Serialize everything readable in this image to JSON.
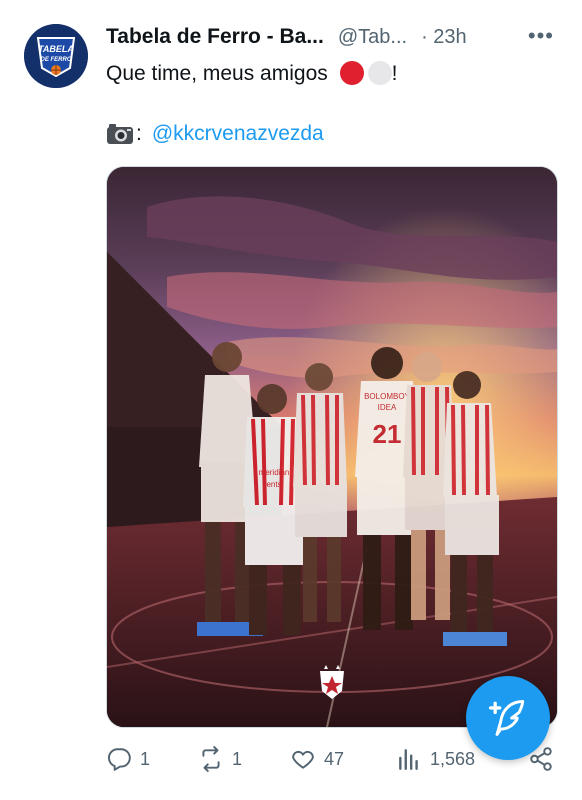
{
  "tweet": {
    "author_name": "Tabela de Ferro - Ba...",
    "author_handle": "@Tab...",
    "separator": "·",
    "time": "23h",
    "text": "Que time, meus amigos",
    "text_end": "!",
    "camera_suffix": ":",
    "mention": "@kkcrvenazvezda",
    "avatar_logo_lines": [
      "TABELA",
      "DE FERRO"
    ],
    "image_jersey_texts": {
      "sponsor_1": "meridian",
      "sponsor_2": "ents",
      "sponsor_3": "BOLOMBOY",
      "sponsor_4": "IDEA",
      "number": "21"
    }
  },
  "actions": {
    "replies": "1",
    "reposts": "1",
    "likes": "47",
    "views": "1,568"
  },
  "icons": {
    "more": "more-dots-icon",
    "reply": "reply-icon",
    "repost": "repost-icon",
    "like": "heart-icon",
    "views": "views-chart-icon",
    "share": "share-icon",
    "compose": "compose-feather-icon",
    "camera": "camera-icon"
  },
  "colors": {
    "accent": "#1d9bf0",
    "secondary_text": "#536471",
    "red_circle": "#e0202e",
    "white_circle": "#e7e7e9"
  }
}
